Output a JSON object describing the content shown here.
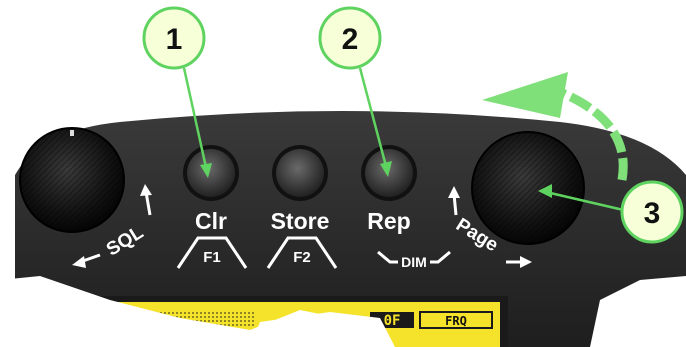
{
  "device": {
    "buttons": [
      {
        "label": "Clr"
      },
      {
        "label": "Store"
      },
      {
        "label": "Rep"
      }
    ],
    "function_labels": [
      "F1",
      "F2",
      "DIM"
    ],
    "knob_labels": {
      "left": "SQL",
      "right": "Page"
    },
    "display": {
      "right_text": "FRQ",
      "segment_text": "0F"
    }
  },
  "callouts": [
    {
      "number": "1"
    },
    {
      "number": "2"
    },
    {
      "number": "3"
    }
  ],
  "colors": {
    "panel": "#2a2a2a",
    "callout_circle_stroke": "#5fd35f",
    "callout_circle_fill": "#f6ffd8",
    "rotation_arrow": "#7fe07a",
    "lcd": "#f5e22a"
  }
}
